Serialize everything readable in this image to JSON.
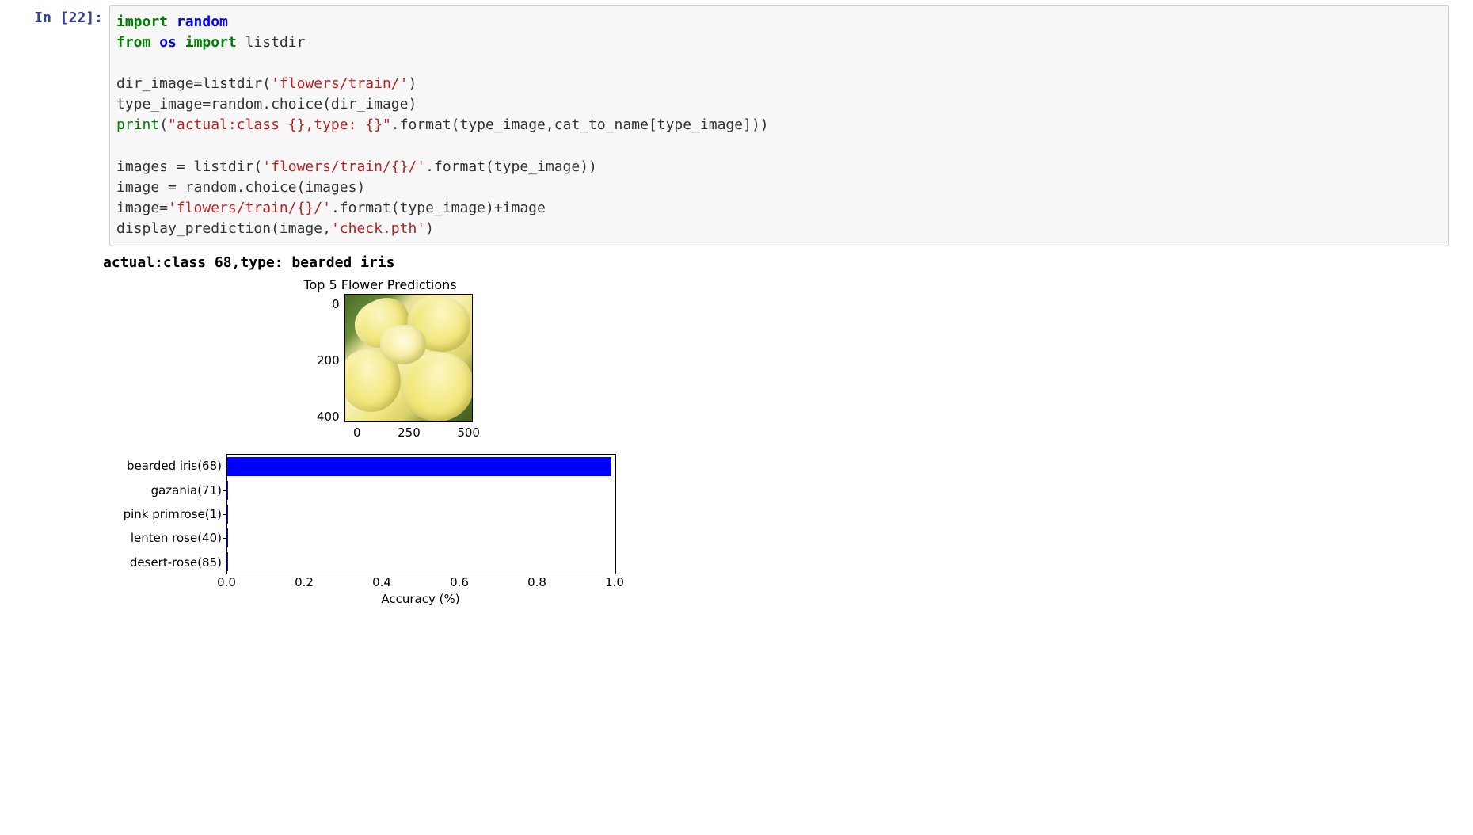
{
  "prompt": "In [22]:",
  "code": {
    "line1_import": "import",
    "line1_module": "random",
    "line2_from": "from",
    "line2_module": "os",
    "line2_import": "import",
    "line2_name": "listdir",
    "line4_a": "dir_image",
    "line4_eq": "=",
    "line4_fn": "listdir(",
    "line4_str": "'flowers/train/'",
    "line4_close": ")",
    "line5": "type_image=random.choice(dir_image)",
    "line6_print": "print",
    "line6_open": "(",
    "line6_str": "\"actual:class {},type: {}\"",
    "line6_rest": ".format(type_image,cat_to_name[type_image]))",
    "line8_a": "images = listdir(",
    "line8_str": "'flowers/train/{}/'",
    "line8_rest": ".format(type_image))",
    "line9": "image = random.choice(images)",
    "line10_a": "image=",
    "line10_str": "'flowers/train/{}/'",
    "line10_rest": ".format(type_image)+image",
    "line11_a": "display_prediction(image,",
    "line11_str": "'check.pth'",
    "line11_close": ")"
  },
  "output": {
    "stream": "actual:class 68,type: bearded iris"
  },
  "figure": {
    "title": "Top 5 Flower Predictions",
    "image_yticks": [
      "0",
      "200",
      "400"
    ],
    "image_xticks": [
      "0",
      "250",
      "500"
    ],
    "bar_xlabel": "Accuracy (%)",
    "bar_xticks": [
      "0.0",
      "0.2",
      "0.4",
      "0.6",
      "0.8",
      "1.0"
    ]
  },
  "chart_data": {
    "type": "bar",
    "orientation": "horizontal",
    "title": "Top 5 Flower Predictions",
    "xlabel": "Accuracy (%)",
    "xlim": [
      0.0,
      1.0
    ],
    "categories": [
      "bearded iris(68)",
      "gazania(71)",
      "pink primrose(1)",
      "lenten rose(40)",
      "desert-rose(85)"
    ],
    "values": [
      0.99,
      0.003,
      0.002,
      0.002,
      0.002
    ]
  }
}
